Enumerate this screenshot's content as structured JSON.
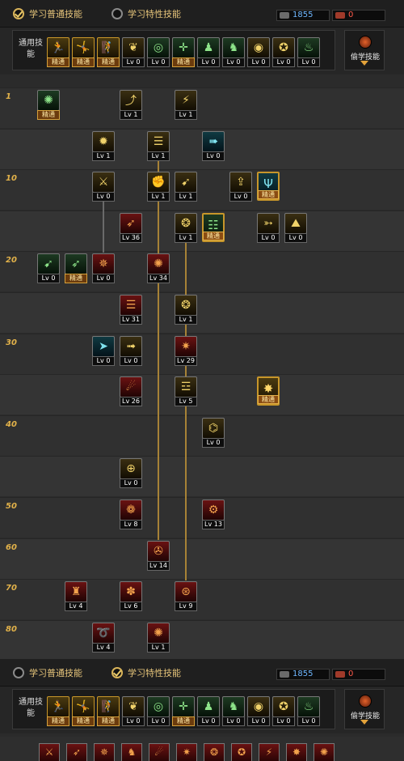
{
  "top": {
    "tabs": [
      {
        "label": "学习普通技能",
        "selected": true
      },
      {
        "label": "学习特性技能",
        "selected": false
      }
    ],
    "sp": "1855",
    "tp": "0",
    "common_label": "通用技能",
    "steal_label": "偷学技能"
  },
  "bottom": {
    "tabs": [
      {
        "label": "学习普通技能",
        "selected": false
      },
      {
        "label": "学习特性技能",
        "selected": true
      }
    ],
    "sp": "1855",
    "tp": "0",
    "common_label": "通用技能",
    "steal_label": "偷学技能"
  },
  "common_skills": [
    {
      "icon": "running-icon",
      "label": "精通",
      "color": "gold",
      "glyph": "🏃"
    },
    {
      "icon": "backstep-icon",
      "label": "精通",
      "color": "gold",
      "glyph": "🤸"
    },
    {
      "icon": "leap-icon",
      "label": "精通",
      "color": "gold",
      "glyph": "🧗"
    },
    {
      "icon": "wings-icon",
      "label": "Lv 0",
      "color": "yellow",
      "glyph": "❦"
    },
    {
      "icon": "target-icon",
      "label": "Lv 0",
      "color": "green",
      "glyph": "◎"
    },
    {
      "icon": "crosshair-icon",
      "label": "精通",
      "color": "green",
      "glyph": "✛"
    },
    {
      "icon": "figure-icon",
      "label": "Lv 0",
      "color": "green",
      "glyph": "♟"
    },
    {
      "icon": "figure-alt-icon",
      "label": "Lv 0",
      "color": "green",
      "glyph": "♞"
    },
    {
      "icon": "eye-icon",
      "label": "Lv 0",
      "color": "yellow",
      "glyph": "◉"
    },
    {
      "icon": "strength-icon",
      "label": "Lv 0",
      "color": "yellow",
      "glyph": "✪"
    },
    {
      "icon": "aura-icon",
      "label": "Lv 0",
      "color": "green",
      "glyph": "♨"
    }
  ],
  "level_labels": [
    "1",
    "10",
    "20",
    "30",
    "40",
    "50",
    "60",
    "70",
    "80"
  ],
  "skills": [
    {
      "row": 0,
      "col": 0,
      "label": "精通",
      "color": "green",
      "icon": "rune-icon",
      "glyph": "✺"
    },
    {
      "row": 0,
      "col": 3,
      "label": "Lv 1",
      "color": "yellow",
      "icon": "uppercut-icon",
      "glyph": "⤴"
    },
    {
      "row": 0,
      "col": 5,
      "label": "Lv 1",
      "color": "yellow",
      "icon": "kick-icon",
      "glyph": "⚡"
    },
    {
      "row": 1,
      "col": 2,
      "label": "Lv 1",
      "color": "yellow",
      "icon": "burst-icon",
      "glyph": "✹"
    },
    {
      "row": 1,
      "col": 4,
      "label": "Lv 1",
      "color": "yellow",
      "icon": "bullet-icon",
      "glyph": "☰"
    },
    {
      "row": 1,
      "col": 6,
      "label": "Lv 0",
      "color": "teal",
      "icon": "dash-icon",
      "glyph": "➠"
    },
    {
      "row": 2,
      "col": 2,
      "label": "Lv 0",
      "color": "yellow",
      "icon": "slash-icon",
      "glyph": "⚔"
    },
    {
      "row": 2,
      "col": 4,
      "label": "Lv 1",
      "color": "yellow",
      "icon": "punch-icon",
      "glyph": "✊"
    },
    {
      "row": 2,
      "col": 5,
      "label": "Lv 1",
      "color": "yellow",
      "icon": "spear-icon",
      "glyph": "➹"
    },
    {
      "row": 2,
      "col": 7,
      "label": "Lv 0",
      "color": "yellow",
      "icon": "arrow-up-icon",
      "glyph": "⇪"
    },
    {
      "row": 2,
      "col": 8,
      "label": "精通",
      "color": "teal",
      "icon": "scythe-icon",
      "glyph": "Ψ",
      "big": true
    },
    {
      "row": 3,
      "col": 3,
      "label": "Lv 36",
      "color": "red",
      "icon": "shot-icon",
      "glyph": "➶"
    },
    {
      "row": 3,
      "col": 5,
      "label": "Lv 1",
      "color": "yellow",
      "icon": "grenade-icon",
      "glyph": "❂"
    },
    {
      "row": 3,
      "col": 6,
      "label": "精通",
      "color": "green",
      "icon": "list-icon",
      "glyph": "☷",
      "big": true
    },
    {
      "row": 3,
      "col": 8,
      "label": "Lv 0",
      "color": "yellow",
      "icon": "bow-icon",
      "glyph": "➳"
    },
    {
      "row": 3,
      "col": 9,
      "label": "Lv 0",
      "color": "yellow",
      "icon": "mountain-icon",
      "glyph": "⛰"
    },
    {
      "row": 4,
      "col": 0,
      "label": "Lv 0",
      "color": "green",
      "icon": "rifle-icon",
      "glyph": "➹"
    },
    {
      "row": 4,
      "col": 1,
      "label": "精通",
      "color": "green",
      "icon": "bow-green-icon",
      "glyph": "➶"
    },
    {
      "row": 4,
      "col": 2,
      "label": "Lv 0",
      "color": "red",
      "icon": "flame-icon",
      "glyph": "✵"
    },
    {
      "row": 4,
      "col": 4,
      "label": "Lv 34",
      "color": "red",
      "icon": "fire-burst-icon",
      "glyph": "✺"
    },
    {
      "row": 5,
      "col": 3,
      "label": "Lv 31",
      "color": "red",
      "icon": "gatling-icon",
      "glyph": "☰"
    },
    {
      "row": 5,
      "col": 5,
      "label": "Lv 1",
      "color": "yellow",
      "icon": "grenade-throw-icon",
      "glyph": "❂"
    },
    {
      "row": 6,
      "col": 2,
      "label": "Lv 0",
      "color": "teal",
      "icon": "thrust-icon",
      "glyph": "➤"
    },
    {
      "row": 6,
      "col": 3,
      "label": "Lv 0",
      "color": "yellow",
      "icon": "missile-icon",
      "glyph": "➟"
    },
    {
      "row": 6,
      "col": 5,
      "label": "Lv 29",
      "color": "red",
      "icon": "barrage-icon",
      "glyph": "✷"
    },
    {
      "row": 7,
      "col": 3,
      "label": "Lv 26",
      "color": "red",
      "icon": "fireball-icon",
      "glyph": "☄"
    },
    {
      "row": 7,
      "col": 5,
      "label": "Lv 5",
      "color": "yellow",
      "icon": "turret-icon",
      "glyph": "☲"
    },
    {
      "row": 7,
      "col": 8,
      "label": "精通",
      "color": "gold",
      "icon": "blast-icon",
      "glyph": "✸",
      "big": true
    },
    {
      "row": 8,
      "col": 6,
      "label": "Lv 0",
      "color": "yellow",
      "icon": "cannon-icon",
      "glyph": "⌬"
    },
    {
      "row": 9,
      "col": 3,
      "label": "Lv 0",
      "color": "yellow",
      "icon": "scope-icon",
      "glyph": "⊕"
    },
    {
      "row": 10,
      "col": 3,
      "label": "Lv 8",
      "color": "red",
      "icon": "chaos-icon",
      "glyph": "❁"
    },
    {
      "row": 10,
      "col": 6,
      "label": "Lv 13",
      "color": "red",
      "icon": "laser-icon",
      "glyph": "⚙"
    },
    {
      "row": 11,
      "col": 4,
      "label": "Lv 14",
      "color": "red",
      "icon": "satellite-icon",
      "glyph": "✇"
    },
    {
      "row": 12,
      "col": 1,
      "label": "Lv 4",
      "color": "red",
      "icon": "mech-icon",
      "glyph": "♜"
    },
    {
      "row": 12,
      "col": 3,
      "label": "Lv 6",
      "color": "red",
      "icon": "storm-icon",
      "glyph": "✽"
    },
    {
      "row": 12,
      "col": 5,
      "label": "Lv 9",
      "color": "red",
      "icon": "orbital-icon",
      "glyph": "⊛"
    },
    {
      "row": 13,
      "col": 2,
      "label": "Lv 4",
      "color": "red",
      "icon": "spiral-icon",
      "glyph": "➰"
    },
    {
      "row": 13,
      "col": 4,
      "label": "Lv 1",
      "color": "red",
      "icon": "nova-icon",
      "glyph": "✺"
    }
  ],
  "bottom_icons": [
    "⚔",
    "➶",
    "✵",
    "♞",
    "☄",
    "✷",
    "❂",
    "✪",
    "⚡",
    "✸",
    "✺"
  ]
}
